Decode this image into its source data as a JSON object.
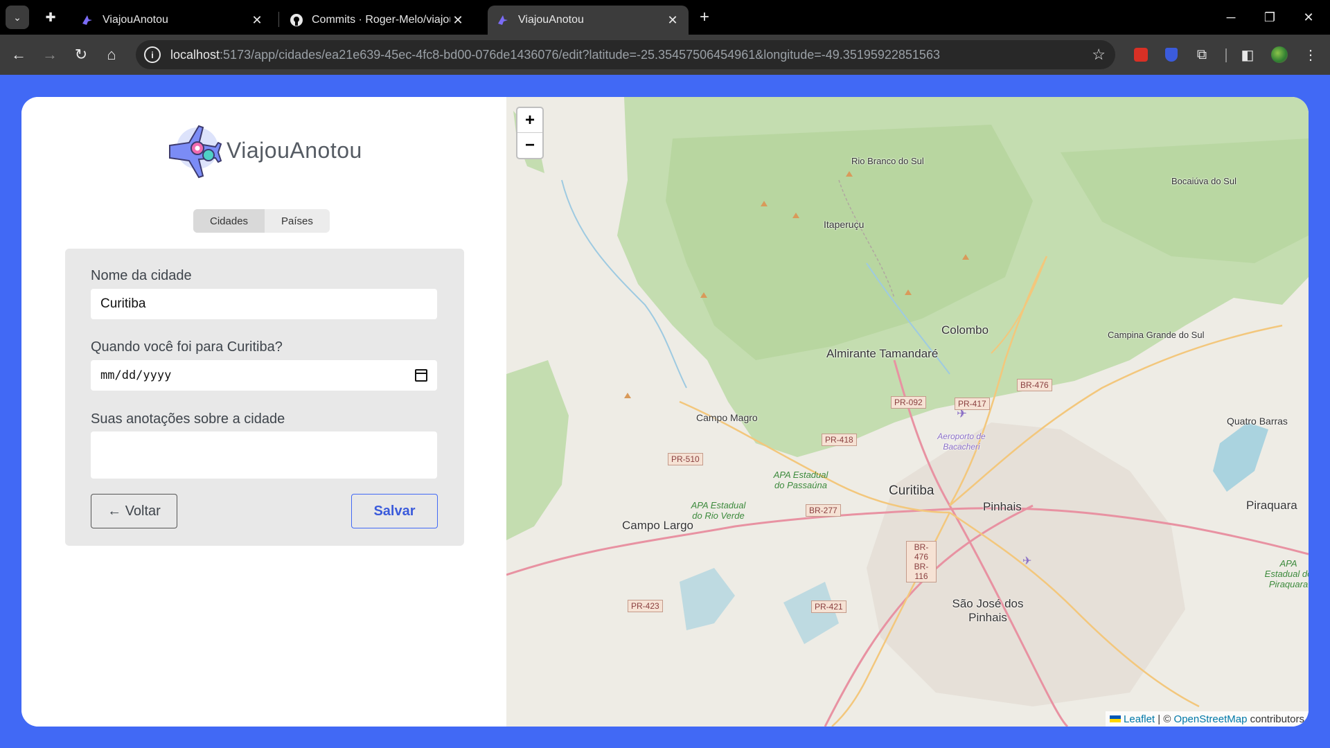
{
  "browser": {
    "tabs": [
      {
        "title": "ViajouAnotou",
        "active": false
      },
      {
        "title": "Commits · Roger-Melo/viajou-a",
        "active": false
      },
      {
        "title": "ViajouAnotou",
        "active": true
      }
    ],
    "url_host": "localhost",
    "url_rest": ":5173/app/cidades/ea21e639-45ec-4fc8-bd00-076de1436076/edit?latitude=-25.35457506454961&longitude=-49.35195922851563"
  },
  "app": {
    "logo_text": "ViajouAnotou",
    "tabs": [
      {
        "label": "Cidades",
        "selected": true
      },
      {
        "label": "Países",
        "selected": false
      }
    ],
    "form": {
      "city_label": "Nome da cidade",
      "city_value": "Curitiba",
      "date_label": "Quando você foi para Curitiba?",
      "date_placeholder": "mm/dd/yyyy",
      "notes_label": "Suas anotações sobre a cidade",
      "notes_value": "",
      "back_label": "← Voltar",
      "save_label": "Salvar"
    },
    "accent_color": "#4169f5"
  },
  "map": {
    "zoom_in": "+",
    "zoom_out": "−",
    "attribution": {
      "leaflet": "Leaflet",
      "sep": " | © ",
      "osm": "OpenStreetMap",
      "tail": " contributors"
    },
    "places": [
      {
        "name": "Rio Branco do Sul",
        "kind": "small"
      },
      {
        "name": "Bocaiúva do Sul",
        "kind": "small"
      },
      {
        "name": "Itaperuçu",
        "kind": "normal"
      },
      {
        "name": "Colombo",
        "kind": "big"
      },
      {
        "name": "Almirante Tamandaré",
        "kind": "big"
      },
      {
        "name": "Campina Grande do Sul",
        "kind": "small"
      },
      {
        "name": "Campo Magro",
        "kind": "normal"
      },
      {
        "name": "Quatro Barras",
        "kind": "normal"
      },
      {
        "name": "Curitiba",
        "kind": "big"
      },
      {
        "name": "Pinhais",
        "kind": "big"
      },
      {
        "name": "Piraquara",
        "kind": "big"
      },
      {
        "name": "Campo Largo",
        "kind": "big"
      },
      {
        "name": "São José dos Pinhais",
        "kind": "big"
      },
      {
        "name": "Aeroporto de Bacacheri",
        "kind": "small"
      }
    ],
    "shields": [
      "PR-092",
      "PR-417",
      "BR-476",
      "PR-418",
      "PR-510",
      "BR-277",
      "BR-476 BR-116",
      "PR-423",
      "PR-421"
    ],
    "protected_areas": [
      "APA Estadual do Passaúna",
      "APA Estadual do Rio Verde",
      "APA Estadual do Piraquara"
    ]
  }
}
